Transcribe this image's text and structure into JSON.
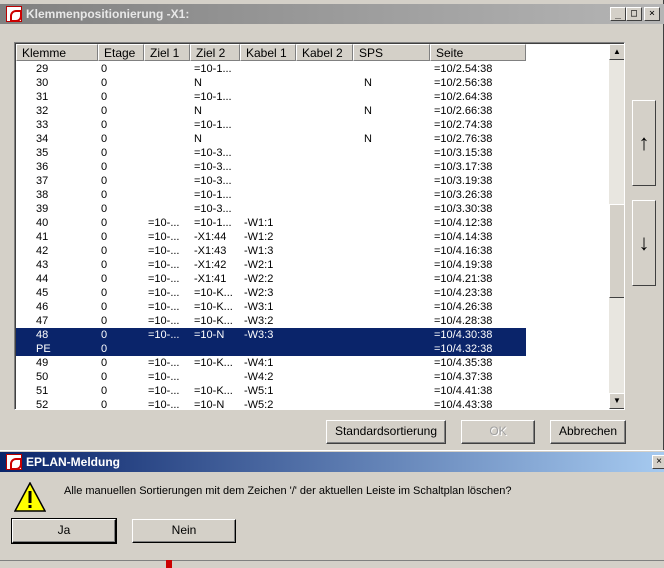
{
  "window": {
    "title": "Klemmenpositionierung -X1:",
    "minimize_glyph": "_",
    "maximize_glyph": "□",
    "close_glyph": "×"
  },
  "grid": {
    "columns": [
      "Klemme",
      "Etage",
      "Ziel 1",
      "Ziel 2",
      "Kabel 1",
      "Kabel 2",
      "SPS",
      "Seite"
    ],
    "rows": [
      [
        "29",
        "0",
        "",
        "=10-1...",
        "",
        "",
        "",
        "=10/2.54:38"
      ],
      [
        "30",
        "0",
        "",
        "N",
        "",
        "",
        "N",
        "=10/2.56:38"
      ],
      [
        "31",
        "0",
        "",
        "=10-1...",
        "",
        "",
        "",
        "=10/2.64:38"
      ],
      [
        "32",
        "0",
        "",
        "N",
        "",
        "",
        "N",
        "=10/2.66:38"
      ],
      [
        "33",
        "0",
        "",
        "=10-1...",
        "",
        "",
        "",
        "=10/2.74:38"
      ],
      [
        "34",
        "0",
        "",
        "N",
        "",
        "",
        "N",
        "=10/2.76:38"
      ],
      [
        "35",
        "0",
        "",
        "=10-3...",
        "",
        "",
        "",
        "=10/3.15:38"
      ],
      [
        "36",
        "0",
        "",
        "=10-3...",
        "",
        "",
        "",
        "=10/3.17:38"
      ],
      [
        "37",
        "0",
        "",
        "=10-3...",
        "",
        "",
        "",
        "=10/3.19:38"
      ],
      [
        "38",
        "0",
        "",
        "=10-1...",
        "",
        "",
        "",
        "=10/3.26:38"
      ],
      [
        "39",
        "0",
        "",
        "=10-3...",
        "",
        "",
        "",
        "=10/3.30:38"
      ],
      [
        "40",
        "0",
        "=10-...",
        "=10-1...",
        "-W1:1",
        "",
        "",
        "=10/4.12:38"
      ],
      [
        "41",
        "0",
        "=10-...",
        "-X1:44",
        "-W1:2",
        "",
        "",
        "=10/4.14:38"
      ],
      [
        "42",
        "0",
        "=10-...",
        "-X1:43",
        "-W1:3",
        "",
        "",
        "=10/4.16:38"
      ],
      [
        "43",
        "0",
        "=10-...",
        "-X1:42",
        "-W2:1",
        "",
        "",
        "=10/4.19:38"
      ],
      [
        "44",
        "0",
        "=10-...",
        "-X1:41",
        "-W2:2",
        "",
        "",
        "=10/4.21:38"
      ],
      [
        "45",
        "0",
        "=10-...",
        "=10-K...",
        "-W2:3",
        "",
        "",
        "=10/4.23:38"
      ],
      [
        "46",
        "0",
        "=10-...",
        "=10-K...",
        "-W3:1",
        "",
        "",
        "=10/4.26:38"
      ],
      [
        "47",
        "0",
        "=10-...",
        "=10-K...",
        "-W3:2",
        "",
        "",
        "=10/4.28:38"
      ],
      [
        "48",
        "0",
        "=10-...",
        "=10-N",
        "-W3:3",
        "",
        "",
        "=10/4.30:38"
      ],
      [
        "PE",
        "0",
        "",
        "",
        "",
        "",
        "",
        "=10/4.32:38"
      ],
      [
        "49",
        "0",
        "=10-...",
        "=10-K...",
        "-W4:1",
        "",
        "",
        "=10/4.35:38"
      ],
      [
        "50",
        "0",
        "=10-...",
        "",
        "-W4:2",
        "",
        "",
        "=10/4.37:38"
      ],
      [
        "51",
        "0",
        "=10-...",
        "=10-K...",
        "-W5:1",
        "",
        "",
        "=10/4.41:38"
      ],
      [
        "52",
        "0",
        "=10-...",
        "=10-N",
        "-W5:2",
        "",
        "",
        "=10/4.43:38"
      ]
    ],
    "selected_rows": [
      19,
      20
    ]
  },
  "buttons": {
    "standard_sort": "Standardsortierung",
    "ok": "OK",
    "cancel": "Abbrechen",
    "move_up_glyph": "↑",
    "move_down_glyph": "↓"
  },
  "message": {
    "title": "EPLAN-Meldung",
    "text": "Alle manuellen Sortierungen mit dem Zeichen '/' der aktuellen Leiste im Schaltplan löschen?",
    "yes": "Ja",
    "no": "Nein",
    "close_glyph": "×"
  }
}
